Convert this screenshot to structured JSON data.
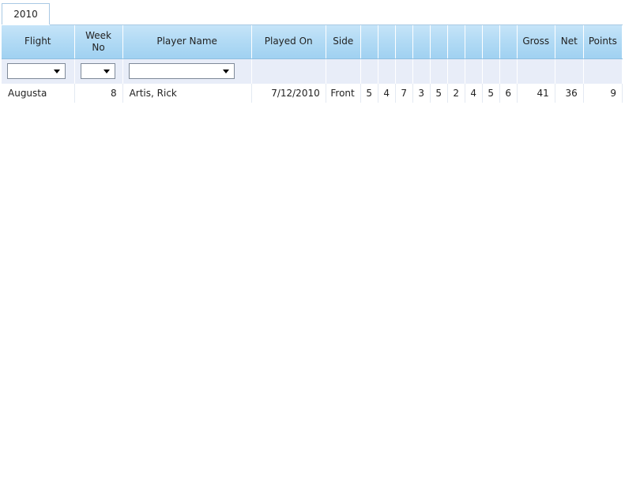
{
  "year_tab": {
    "label": "2010"
  },
  "columns": [
    {
      "label": "Flight"
    },
    {
      "label": "Week\nNo"
    },
    {
      "label": "Player Name"
    },
    {
      "label": "Played On"
    },
    {
      "label": "Side"
    },
    {
      "label": ""
    },
    {
      "label": ""
    },
    {
      "label": ""
    },
    {
      "label": ""
    },
    {
      "label": ""
    },
    {
      "label": ""
    },
    {
      "label": ""
    },
    {
      "label": ""
    },
    {
      "label": ""
    },
    {
      "label": "Gross"
    },
    {
      "label": "Net"
    },
    {
      "label": "Points"
    }
  ],
  "filters": {
    "flight": {
      "value": ""
    },
    "week_no": {
      "value": ""
    },
    "player_name": {
      "value": ""
    }
  },
  "rows": [
    {
      "flight": "Augusta",
      "week_no": "8",
      "player_name": "Artis, Rick",
      "played_on": "7/12/2010",
      "side": "Front",
      "holes": [
        "5",
        "4",
        "7",
        "3",
        "5",
        "2",
        "4",
        "5",
        "6"
      ],
      "gross": "41",
      "net": "36",
      "points": "9"
    }
  ]
}
